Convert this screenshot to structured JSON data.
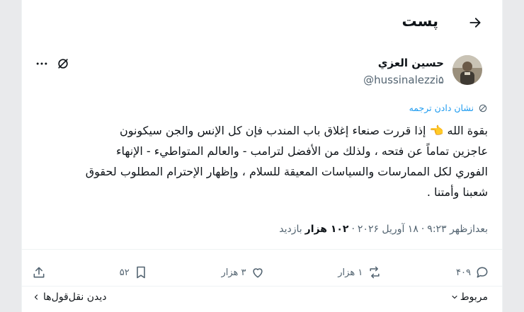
{
  "header": {
    "title": "پست",
    "back_icon": "arrow-right-icon"
  },
  "author": {
    "name": "حسين العزي",
    "handle": "@hussinalezzi۵"
  },
  "translate": {
    "label": "نشان دادن ترجمه"
  },
  "tweet": {
    "lines": [
      "بقوة الله 👈 إذا قررت صنعاء إغلاق باب المندب فإن كل الإنس والجن سيكونون",
      "عاجزين تماماً عن فتحه ، ولذلك من الأفضل لترامب - والعالم المتواطيء - الإنهاء",
      "الفوري لكل الممارسات والسياسات المعيقة للسلام ، وإظهار الإحترام المطلوب لحقوق",
      "شعبنا وأمتنا ."
    ]
  },
  "meta": {
    "time": "بعدازظهر ۹:۲۳",
    "sep1": "·",
    "date": "۱۸ آوریل ۲۰۲۶",
    "sep2": "·",
    "views_count": "۱۰۲ هزار",
    "views_label": "بازدید"
  },
  "actions": {
    "replies": "۴۰۹",
    "reposts": "۱ هزار",
    "likes": "۳ هزار",
    "bookmarks": "۵۲"
  },
  "footer": {
    "related": "مربوط",
    "quotes": "دیدن نقل‌قول‌ها"
  },
  "colors": {
    "accent": "#1d9bf0",
    "muted": "#536471",
    "text": "#0f1419"
  }
}
